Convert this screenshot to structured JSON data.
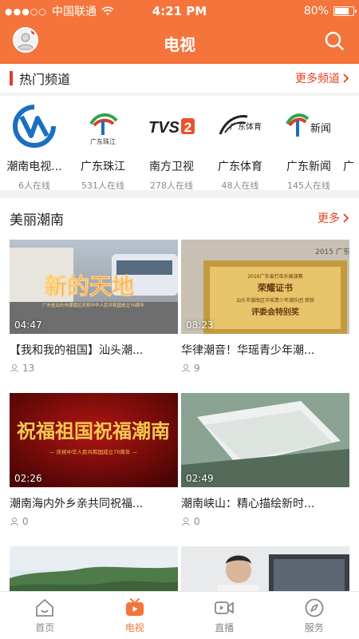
{
  "status_bar": {
    "carrier": "中国联通",
    "time": "4:21 PM",
    "battery": "80%",
    "battery_level": 0.8
  },
  "header": {
    "title": "电视"
  },
  "hot_channels": {
    "title": "热门频道",
    "more_label": "更多频道",
    "items": [
      {
        "name": "潮南电视...",
        "online": "6人在线",
        "logo": "chaonan-tv-logo"
      },
      {
        "name": "广东珠江",
        "online": "531人在线",
        "logo": "guangdong-zhujiang-logo",
        "logo_text": "广东珠江"
      },
      {
        "name": "南方卫视",
        "online": "278人在线",
        "logo": "tvs2-logo",
        "logo_text": "TVS2"
      },
      {
        "name": "广东体育",
        "online": "48人在线",
        "logo": "guangdong-sports-logo",
        "logo_text": "广东体育"
      },
      {
        "name": "广东新闻",
        "online": "145人在线",
        "logo": "guangdong-news-logo",
        "logo_text": "新闻"
      },
      {
        "name": "广",
        "online": "",
        "logo": "partial-logo"
      }
    ]
  },
  "beautiful_chaonan": {
    "title": "美丽潮南",
    "more_label": "更多",
    "videos": [
      {
        "title": "【我和我的祖国】汕头潮...",
        "duration": "04:47",
        "views": "13",
        "overlay": "新的天地",
        "caption": "广东省汕头市潮南区庆祝中华人民共和国成立70周年"
      },
      {
        "title": "华律潮音！华瑶青少年潮...",
        "duration": "08:23",
        "views": "9",
        "overlay": "荣耀证书",
        "cert_line1": "汕头市潮南区华瑶青少年潮乐团 荣获",
        "cert_line2": "评委会特别奖",
        "cert_header": "2016广东省打击乐展演赛",
        "wall_text": "2015 广东"
      },
      {
        "title": "潮南海内外乡亲共同祝福...",
        "duration": "02:26",
        "views": "0",
        "overlay": "祝福祖国祝福潮南",
        "caption": "— 庆祝中华人民共和国成立70周年 —"
      },
      {
        "title": "潮南峡山：精心描绘新时...",
        "duration": "02:49",
        "views": "0"
      },
      {
        "title": "",
        "duration": "",
        "views": ""
      },
      {
        "title": "",
        "duration": "",
        "views": ""
      }
    ]
  },
  "tabbar": {
    "items": [
      {
        "label": "首页",
        "icon": "home-icon",
        "active": false
      },
      {
        "label": "电视",
        "icon": "tv-icon",
        "active": true
      },
      {
        "label": "直播",
        "icon": "live-camera-icon",
        "active": false
      },
      {
        "label": "服务",
        "icon": "compass-icon",
        "active": false
      }
    ]
  },
  "colors": {
    "brand": "#f4743b",
    "accent_red": "#e63a2a",
    "more_red": "#e5421f"
  }
}
